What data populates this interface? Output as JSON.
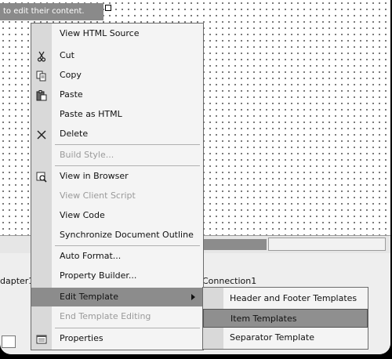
{
  "designer": {
    "hint_text": "to edit their content.",
    "tray_left_label": "dapter1",
    "tray_right_label": "Connection1"
  },
  "context_menu": {
    "items": [
      {
        "label": "View HTML Source",
        "icon": "",
        "disabled": false
      },
      {
        "label": "Cut",
        "icon": "scissors-icon",
        "disabled": false
      },
      {
        "label": "Copy",
        "icon": "copy-icon",
        "disabled": false
      },
      {
        "label": "Paste",
        "icon": "paste-icon",
        "disabled": false
      },
      {
        "label": "Paste as HTML",
        "icon": "",
        "disabled": false
      },
      {
        "label": "Delete",
        "icon": "delete-x-icon",
        "disabled": false
      },
      {
        "label": "Build Style...",
        "icon": "",
        "disabled": true
      },
      {
        "label": "View in Browser",
        "icon": "browser-preview-icon",
        "disabled": false
      },
      {
        "label": "View Client Script",
        "icon": "",
        "disabled": true
      },
      {
        "label": "View Code",
        "icon": "",
        "disabled": false
      },
      {
        "label": "Synchronize Document Outline",
        "icon": "",
        "disabled": false
      },
      {
        "label": "Auto Format...",
        "icon": "",
        "disabled": false
      },
      {
        "label": "Property Builder...",
        "icon": "",
        "disabled": false
      },
      {
        "label": "Edit Template",
        "icon": "",
        "disabled": false,
        "has_submenu": true,
        "highlighted": true
      },
      {
        "label": "End Template Editing",
        "icon": "",
        "disabled": true
      },
      {
        "label": "Properties",
        "icon": "properties-icon",
        "disabled": false
      }
    ]
  },
  "submenu": {
    "items": [
      {
        "label": "Header and Footer Templates"
      },
      {
        "label": "Item Templates",
        "highlighted": true
      },
      {
        "label": "Separator Template"
      }
    ]
  },
  "colors": {
    "menu_background": "#f4f4f4",
    "menu_gutter": "#d9d9d9",
    "highlight": "#8c8c8c",
    "disabled_text": "#9a9a9a"
  }
}
